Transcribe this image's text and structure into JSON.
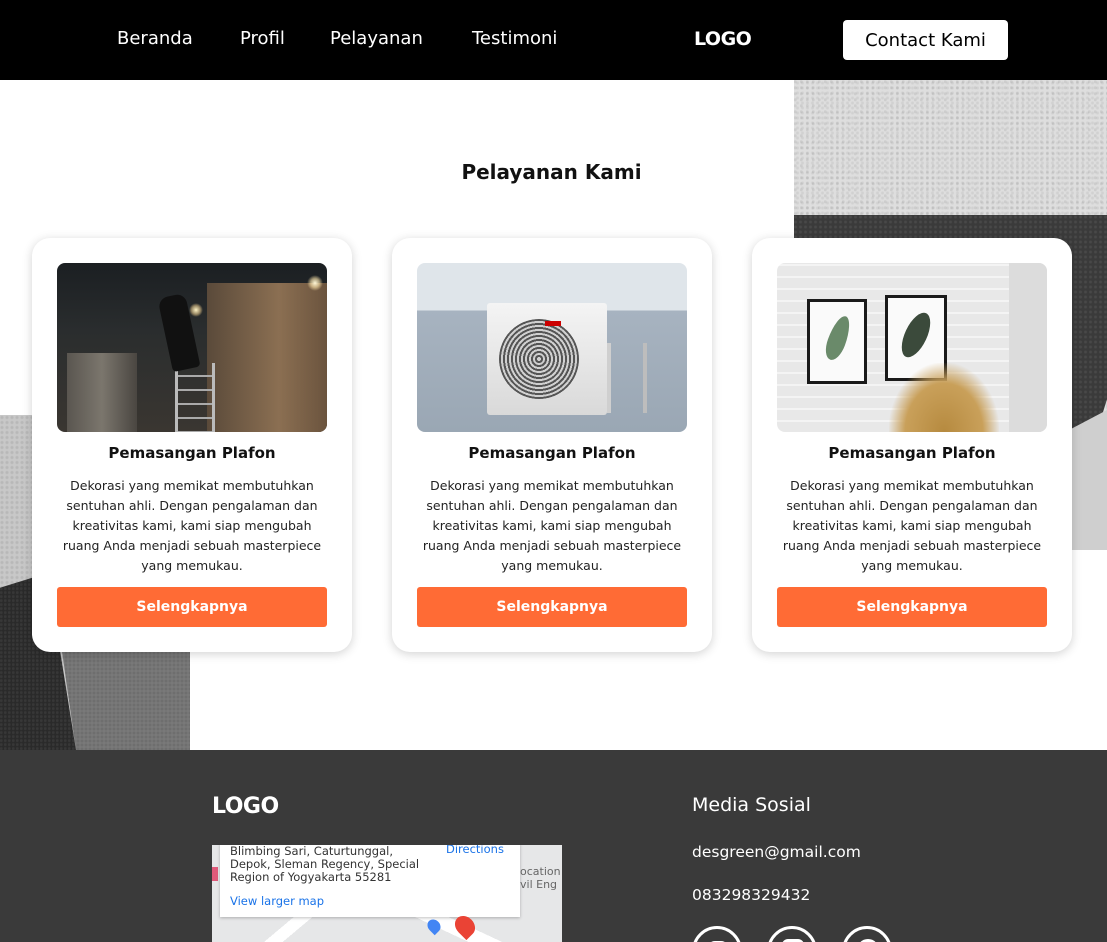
{
  "nav": {
    "links": [
      "Beranda",
      "Profil",
      "Pelayanan",
      "Testimoni"
    ],
    "logo": "LOGO",
    "contact_label": "Contact Kami"
  },
  "section": {
    "title": "Pelayanan Kami",
    "cards": [
      {
        "image": "ceiling-installation-photo",
        "title": "Pemasangan Plafon",
        "description": "Dekorasi yang memikat membutuhkan sentuhan ahli. Dengan pengalaman dan kreativitas kami, kami siap mengubah ruang Anda menjadi sebuah masterpiece yang memukau.",
        "button": "Selengkapnya"
      },
      {
        "image": "air-conditioner-photo",
        "title": "Pemasangan Plafon",
        "description": "Dekorasi yang memikat membutuhkan sentuhan ahli. Dengan pengalaman dan kreativitas kami, kami siap mengubah ruang Anda menjadi sebuah masterpiece yang memukau.",
        "button": "Selengkapnya"
      },
      {
        "image": "wall-frames-photo",
        "title": "Pemasangan Plafon",
        "description": "Dekorasi yang memikat membutuhkan sentuhan ahli. Dengan pengalaman dan kreativitas kami, kami siap mengubah ruang Anda menjadi sebuah masterpiece yang memukau.",
        "button": "Selengkapnya"
      }
    ]
  },
  "footer": {
    "logo": "LOGO",
    "map": {
      "address": "Blimbing Sari, Caturtunggal, Depok, Sleman Regency, Special Region of Yogyakarta 55281",
      "directions": "Directions",
      "larger_map": "View larger map",
      "side_text": "ocation vil Eng"
    },
    "social_title": "Media Sosial",
    "email": "desgreen@gmail.com",
    "phone": "083298329432",
    "social_icons": [
      "youtube-icon",
      "instagram-icon",
      "whatsapp-icon"
    ]
  },
  "colors": {
    "nav_bg": "#000000",
    "accent": "#ff6b35",
    "footer_bg": "#3a3a3a"
  }
}
